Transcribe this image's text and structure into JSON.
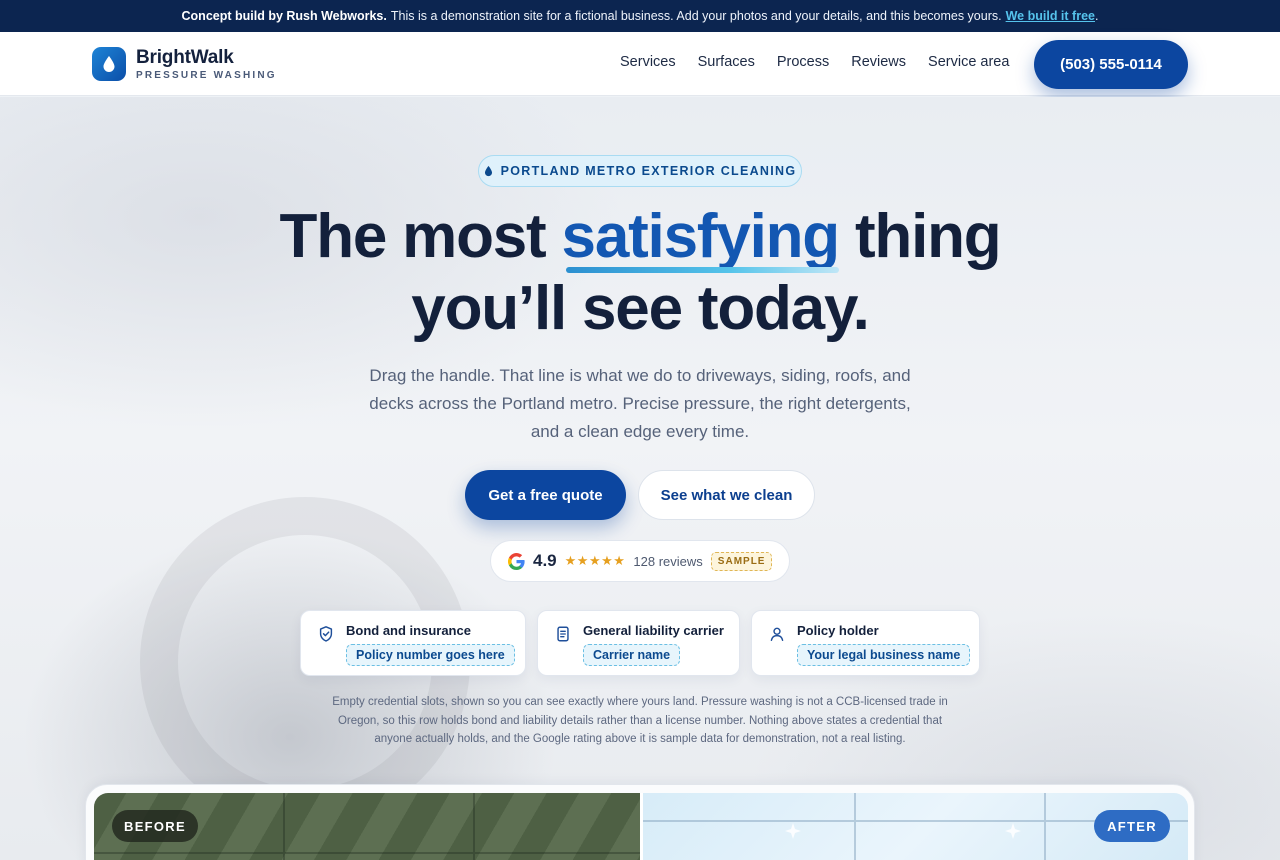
{
  "announcement": {
    "lead": "Concept build by Rush Webworks.",
    "text": "This is a demonstration site for a fictional business. Add your photos and your details, and this becomes yours.",
    "link": "We build it free",
    "trail": "."
  },
  "brand": {
    "name": "BrightWalk",
    "tagline": "PRESSURE WASHING",
    "logo_icon": "water-drop-icon"
  },
  "nav": {
    "items": [
      {
        "label": "Services"
      },
      {
        "label": "Surfaces"
      },
      {
        "label": "Process"
      },
      {
        "label": "Reviews"
      },
      {
        "label": "Service area"
      }
    ],
    "phone": "(503) 555-0114"
  },
  "hero": {
    "badge": "PORTLAND METRO EXTERIOR CLEANING",
    "badge_icon": "water-drop-icon",
    "headline_pre": "The most",
    "headline_accent": "satisfying",
    "headline_post": "thing",
    "headline_line2": "you’ll see today.",
    "subcopy": "Drag the handle. That line is what we do to driveways, siding, roofs, and decks across the Portland metro. Precise pressure, the right detergents, and a clean edge every time.",
    "cta_primary": "Get a free quote",
    "cta_secondary": "See what we clean"
  },
  "rating": {
    "icon": "google-icon",
    "score": "4.9",
    "stars": "★★★★★",
    "stars_value": 5,
    "count": "128 reviews",
    "sample": "SAMPLE"
  },
  "credentials": [
    {
      "title": "Bond and insurance",
      "slot": "Policy number goes here",
      "icon": "shield-check-icon"
    },
    {
      "title": "General liability carrier",
      "slot": "Carrier name",
      "icon": "document-icon"
    },
    {
      "title": "Policy holder",
      "slot": "Your legal business name",
      "icon": "user-icon"
    }
  ],
  "disclaimer": "Empty credential slots, shown so you can see exactly where yours land. Pressure washing is not a CCB-licensed trade in Oregon, so this row holds bond and liability details rather than a license number. Nothing above states a credential that anyone actually holds, and the Google rating above it is sample data for demonstration, not a real listing.",
  "compare": {
    "before_label": "BEFORE",
    "after_label": "AFTER"
  },
  "colors": {
    "navy": "#0c2550",
    "primary": "#0c46a0",
    "accent_link": "#56c3ec",
    "headline": "#13203b",
    "headline_accent": "#1357b2"
  }
}
